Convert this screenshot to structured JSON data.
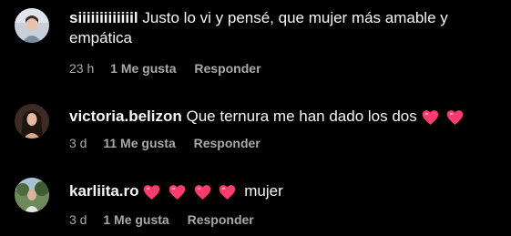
{
  "colors": {
    "background": "#000000",
    "text_primary": "#f5f5f5",
    "text_secondary": "#a8a8a8",
    "heart": "#ff3b6b"
  },
  "comments": [
    {
      "username": "siiiiiiiiiiiiil",
      "text_line1": "Justo lo vi y pensé, que mujer más amable y",
      "text_line2": "empática",
      "time": "23 h",
      "likes": "1 Me gusta",
      "reply": "Responder",
      "emoji_hearts": 0
    },
    {
      "username": "victoria.belizon",
      "text_line1": "Que ternura me han dado los dos",
      "time": "3 d",
      "likes": "11 Me gusta",
      "reply": "Responder",
      "emoji_hearts": 2
    },
    {
      "username": "karliita.ro",
      "text_after_hearts": "mujer",
      "time": "3 d",
      "likes": "1 Me gusta",
      "reply": "Responder",
      "emoji_hearts": 4
    }
  ]
}
